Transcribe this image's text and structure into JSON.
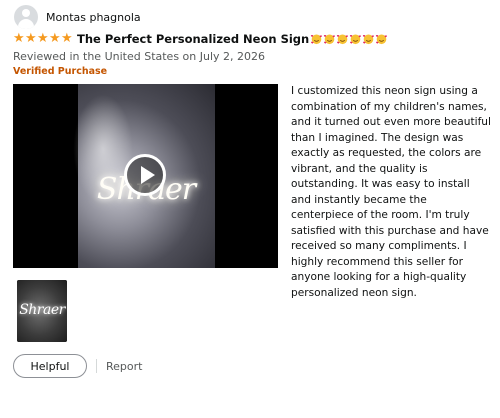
{
  "reviewer": {
    "name": "Montas phagnola",
    "avatar_icon": "user-avatar-icon"
  },
  "review": {
    "rating": 5,
    "max_rating": 5,
    "star_color": "#f59a20",
    "title": "The Perfect Personalized Neon Sign",
    "title_emoji_count": 6,
    "date": "Reviewed in the United States on July 2, 2026",
    "verified": "Verified Purchase",
    "body": "I customized this neon sign using a combination of my children's names, and it turned out even more beautiful than I imagined. The design was exactly as requested, the colors are vibrant, and the quality is outstanding. It was easy to install and instantly became the centerpiece of the room. I'm truly satisfied with this purchase and have received so many compliments. I highly recommend this seller for anyone looking for a high-quality personalized neon sign."
  },
  "media": {
    "video_sign_text": "Shraer",
    "thumbnail_sign_text": "Shraer",
    "play_icon": "play-icon"
  },
  "actions": {
    "helpful_label": "Helpful",
    "report_label": "Report"
  },
  "colors": {
    "verified": "#c45500",
    "meta_text": "#565959"
  }
}
